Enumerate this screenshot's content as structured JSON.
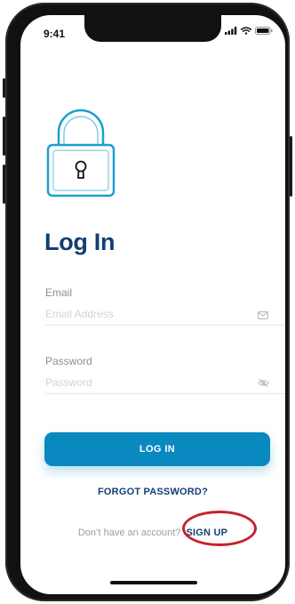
{
  "status_bar": {
    "time": "9:41",
    "icons": [
      "signal-icon",
      "wifi-icon",
      "battery-icon"
    ]
  },
  "screen": {
    "icon": "lock-icon",
    "title": "Log In",
    "email": {
      "label": "Email",
      "placeholder": "Email Address",
      "value": "",
      "icon": "envelope-icon"
    },
    "password": {
      "label": "Password",
      "placeholder": "Password",
      "value": "",
      "icon": "eye-off-icon"
    },
    "login_button": "LOG IN",
    "forgot_password": "FORGOT PASSWORD?",
    "signup_prompt": "Don’t have an account?",
    "signup_link": "SIGN UP"
  },
  "colors": {
    "title": "#133f73",
    "accent_button": "#0a89c0",
    "icon_stroke": "#1aa0cf",
    "highlight_ring": "#c8202b",
    "placeholder": "#d0d3d7"
  }
}
